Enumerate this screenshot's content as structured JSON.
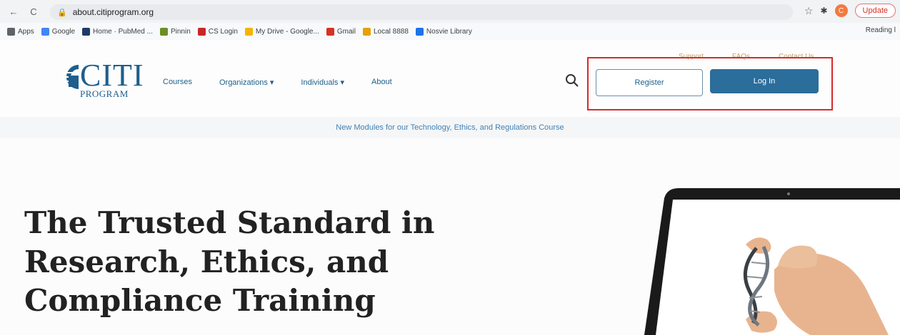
{
  "browser": {
    "back": "←",
    "reload": "C",
    "url": "about.citiprogram.org",
    "profile_initial": "C",
    "update_label": "Update",
    "reading_list": "Reading l"
  },
  "bookmarks": [
    {
      "label": "Apps",
      "color": "#5f6368"
    },
    {
      "label": "Google",
      "color": "#4285f4"
    },
    {
      "label": "Home · PubMed ...",
      "color": "#1f3a66"
    },
    {
      "label": "Pinnin",
      "color": "#6b8e23"
    },
    {
      "label": "CS Login",
      "color": "#c62828"
    },
    {
      "label": "My Drive - Google...",
      "color": "#f4b400"
    },
    {
      "label": "Gmail",
      "color": "#d93025"
    },
    {
      "label": "Local 8888",
      "color": "#e6a100"
    },
    {
      "label": "Nosvie Library",
      "color": "#1a73e8"
    }
  ],
  "site": {
    "logo_text": "CITI",
    "logo_sub": "PROGRAM",
    "nav": [
      "Courses",
      "Organizations ▾",
      "Individuals ▾",
      "About"
    ],
    "utility": [
      "Support",
      "FAQs",
      "Contact Us"
    ],
    "register_label": "Register",
    "login_label": "Log In",
    "banner": "New Modules for our Technology, Ethics, and Regulations Course",
    "hero_lines": [
      "The Trusted Standard in",
      "Research, Ethics, and",
      "Compliance Training"
    ]
  },
  "colors": {
    "brand": "#1e5f8c",
    "login_bg": "#2b6d9b",
    "highlight": "#d62b2b"
  }
}
